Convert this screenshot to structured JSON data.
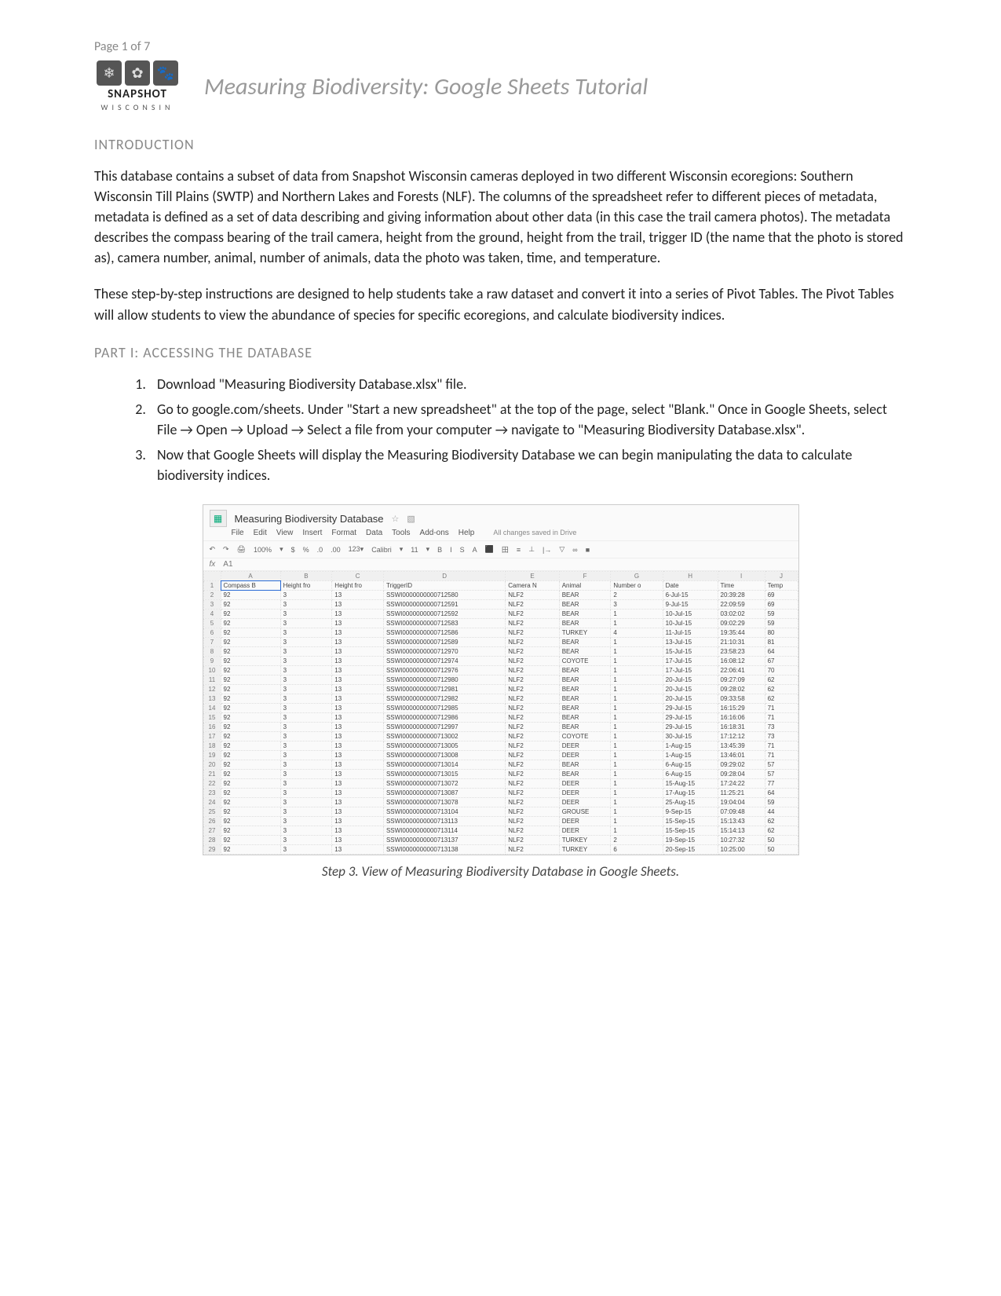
{
  "page_number": "Page 1 of 7",
  "logo": {
    "brand": "SNAPSHOT",
    "sub": "WISCONSIN"
  },
  "doc_title": "Measuring Biodiversity: Google Sheets Tutorial",
  "sections": {
    "intro_heading": "INTRODUCTION",
    "intro_para1": "This database contains a subset of data from Snapshot Wisconsin cameras deployed in two different Wisconsin ecoregions: Southern Wisconsin Till Plains (SWTP) and Northern Lakes and Forests (NLF). The columns of the spreadsheet refer to different pieces of metadata, metadata is defined as a set of data describing and giving information about other data (in this case the trail camera photos). The metadata describes the compass bearing of the trail camera, height from the ground, height from the trail, trigger ID (the name that the photo is stored as), camera number, animal, number of animals, data the photo was taken, time, and temperature.",
    "intro_para2": "These step-by-step instructions are designed to help students take a raw dataset and convert it into a series of Pivot Tables. The Pivot Tables will allow students to view the abundance of species for specific ecoregions, and calculate biodiversity indices.",
    "part1_heading": "PART I: ACCESSING THE DATABASE",
    "steps": [
      "Download \"Measuring Biodiversity Database.xlsx\" file.",
      "Go to google.com/sheets. Under \"Start a new spreadsheet\" at the top of the page, select \"Blank.\" Once in Google Sheets, select File → Open → Upload → Select a file from your computer → navigate to \"Measuring Biodiversity Database.xlsx\".",
      "Now that Google Sheets will display the Measuring Biodiversity Database we can begin manipulating the data to calculate biodiversity indices."
    ]
  },
  "screenshot": {
    "filename": "Measuring Biodiversity Database",
    "menu": [
      "File",
      "Edit",
      "View",
      "Insert",
      "Format",
      "Data",
      "Tools",
      "Add-ons",
      "Help"
    ],
    "saved_msg": "All changes saved in Drive",
    "toolbar": {
      "zoom": "100%",
      "font": "Calibri",
      "fontsize": "11",
      "items": [
        "↶",
        "↷",
        "🖨",
        "$",
        "%",
        ".0",
        ".00",
        "123▾",
        "B",
        "I",
        "S",
        "A",
        "⬛",
        "田",
        "≡",
        "⊥",
        "|→",
        "▽",
        "∞",
        "■"
      ]
    },
    "fx_cell": "A1",
    "col_letters": [
      "A",
      "B",
      "C",
      "D",
      "E",
      "F",
      "G",
      "H",
      "I",
      "J"
    ],
    "headers": [
      "Compass B",
      "Height fro",
      "Height fro",
      "TriggerID",
      "Camera N",
      "Animal",
      "Number o",
      "Date",
      "Time",
      "Temp"
    ],
    "rows": [
      [
        "92",
        "3",
        "13",
        "SSWI0000000000712580",
        "NLF2",
        "BEAR",
        "2",
        "6-Jul-15",
        "20:39:28",
        "69"
      ],
      [
        "92",
        "3",
        "13",
        "SSWI0000000000712591",
        "NLF2",
        "BEAR",
        "3",
        "9-Jul-15",
        "22:09:59",
        "69"
      ],
      [
        "92",
        "3",
        "13",
        "SSWI0000000000712592",
        "NLF2",
        "BEAR",
        "1",
        "10-Jul-15",
        "03:02:02",
        "59"
      ],
      [
        "92",
        "3",
        "13",
        "SSWI0000000000712583",
        "NLF2",
        "BEAR",
        "1",
        "10-Jul-15",
        "09:02:29",
        "59"
      ],
      [
        "92",
        "3",
        "13",
        "SSWI0000000000712586",
        "NLF2",
        "TURKEY",
        "4",
        "11-Jul-15",
        "19:35:44",
        "80"
      ],
      [
        "92",
        "3",
        "13",
        "SSWI0000000000712589",
        "NLF2",
        "BEAR",
        "1",
        "13-Jul-15",
        "21:10:31",
        "81"
      ],
      [
        "92",
        "3",
        "13",
        "SSWI0000000000712970",
        "NLF2",
        "BEAR",
        "1",
        "15-Jul-15",
        "23:58:23",
        "64"
      ],
      [
        "92",
        "3",
        "13",
        "SSWI0000000000712974",
        "NLF2",
        "COYOTE",
        "1",
        "17-Jul-15",
        "16:08:12",
        "67"
      ],
      [
        "92",
        "3",
        "13",
        "SSWI0000000000712976",
        "NLF2",
        "BEAR",
        "1",
        "17-Jul-15",
        "22:06:41",
        "70"
      ],
      [
        "92",
        "3",
        "13",
        "SSWI0000000000712980",
        "NLF2",
        "BEAR",
        "1",
        "20-Jul-15",
        "09:27:09",
        "62"
      ],
      [
        "92",
        "3",
        "13",
        "SSWI0000000000712981",
        "NLF2",
        "BEAR",
        "1",
        "20-Jul-15",
        "09:28:02",
        "62"
      ],
      [
        "92",
        "3",
        "13",
        "SSWI0000000000712982",
        "NLF2",
        "BEAR",
        "1",
        "20-Jul-15",
        "09:33:58",
        "62"
      ],
      [
        "92",
        "3",
        "13",
        "SSWI0000000000712985",
        "NLF2",
        "BEAR",
        "1",
        "29-Jul-15",
        "16:15:29",
        "71"
      ],
      [
        "92",
        "3",
        "13",
        "SSWI0000000000712986",
        "NLF2",
        "BEAR",
        "1",
        "29-Jul-15",
        "16:16:06",
        "71"
      ],
      [
        "92",
        "3",
        "13",
        "SSWI0000000000712997",
        "NLF2",
        "BEAR",
        "1",
        "29-Jul-15",
        "16:18:31",
        "73"
      ],
      [
        "92",
        "3",
        "13",
        "SSWI0000000000713002",
        "NLF2",
        "COYOTE",
        "1",
        "30-Jul-15",
        "17:12:12",
        "73"
      ],
      [
        "92",
        "3",
        "13",
        "SSWI0000000000713005",
        "NLF2",
        "DEER",
        "1",
        "1-Aug-15",
        "13:45:39",
        "71"
      ],
      [
        "92",
        "3",
        "13",
        "SSWI0000000000713008",
        "NLF2",
        "DEER",
        "1",
        "1-Aug-15",
        "13:46:01",
        "71"
      ],
      [
        "92",
        "3",
        "13",
        "SSWI0000000000713014",
        "NLF2",
        "BEAR",
        "1",
        "6-Aug-15",
        "09:29:02",
        "57"
      ],
      [
        "92",
        "3",
        "13",
        "SSWI0000000000713015",
        "NLF2",
        "BEAR",
        "1",
        "6-Aug-15",
        "09:28:04",
        "57"
      ],
      [
        "92",
        "3",
        "13",
        "SSWI0000000000713072",
        "NLF2",
        "DEER",
        "1",
        "15-Aug-15",
        "17:24:22",
        "77"
      ],
      [
        "92",
        "3",
        "13",
        "SSWI0000000000713087",
        "NLF2",
        "DEER",
        "1",
        "17-Aug-15",
        "11:25:21",
        "64"
      ],
      [
        "92",
        "3",
        "13",
        "SSWI0000000000713078",
        "NLF2",
        "DEER",
        "1",
        "25-Aug-15",
        "19:04:04",
        "59"
      ],
      [
        "92",
        "3",
        "13",
        "SSWI0000000000713104",
        "NLF2",
        "GROUSE",
        "1",
        "9-Sep-15",
        "07:09:48",
        "44"
      ],
      [
        "92",
        "3",
        "13",
        "SSWI0000000000713113",
        "NLF2",
        "DEER",
        "1",
        "15-Sep-15",
        "15:13:43",
        "62"
      ],
      [
        "92",
        "3",
        "13",
        "SSWI0000000000713114",
        "NLF2",
        "DEER",
        "1",
        "15-Sep-15",
        "15:14:13",
        "62"
      ],
      [
        "92",
        "3",
        "13",
        "SSWI0000000000713137",
        "NLF2",
        "TURKEY",
        "2",
        "19-Sep-15",
        "10:27:32",
        "50"
      ],
      [
        "92",
        "3",
        "13",
        "SSWI0000000000713138",
        "NLF2",
        "TURKEY",
        "6",
        "20-Sep-15",
        "10:25:00",
        "50"
      ]
    ]
  },
  "caption": "Step 3. View of Measuring Biodiversity Database in Google Sheets."
}
